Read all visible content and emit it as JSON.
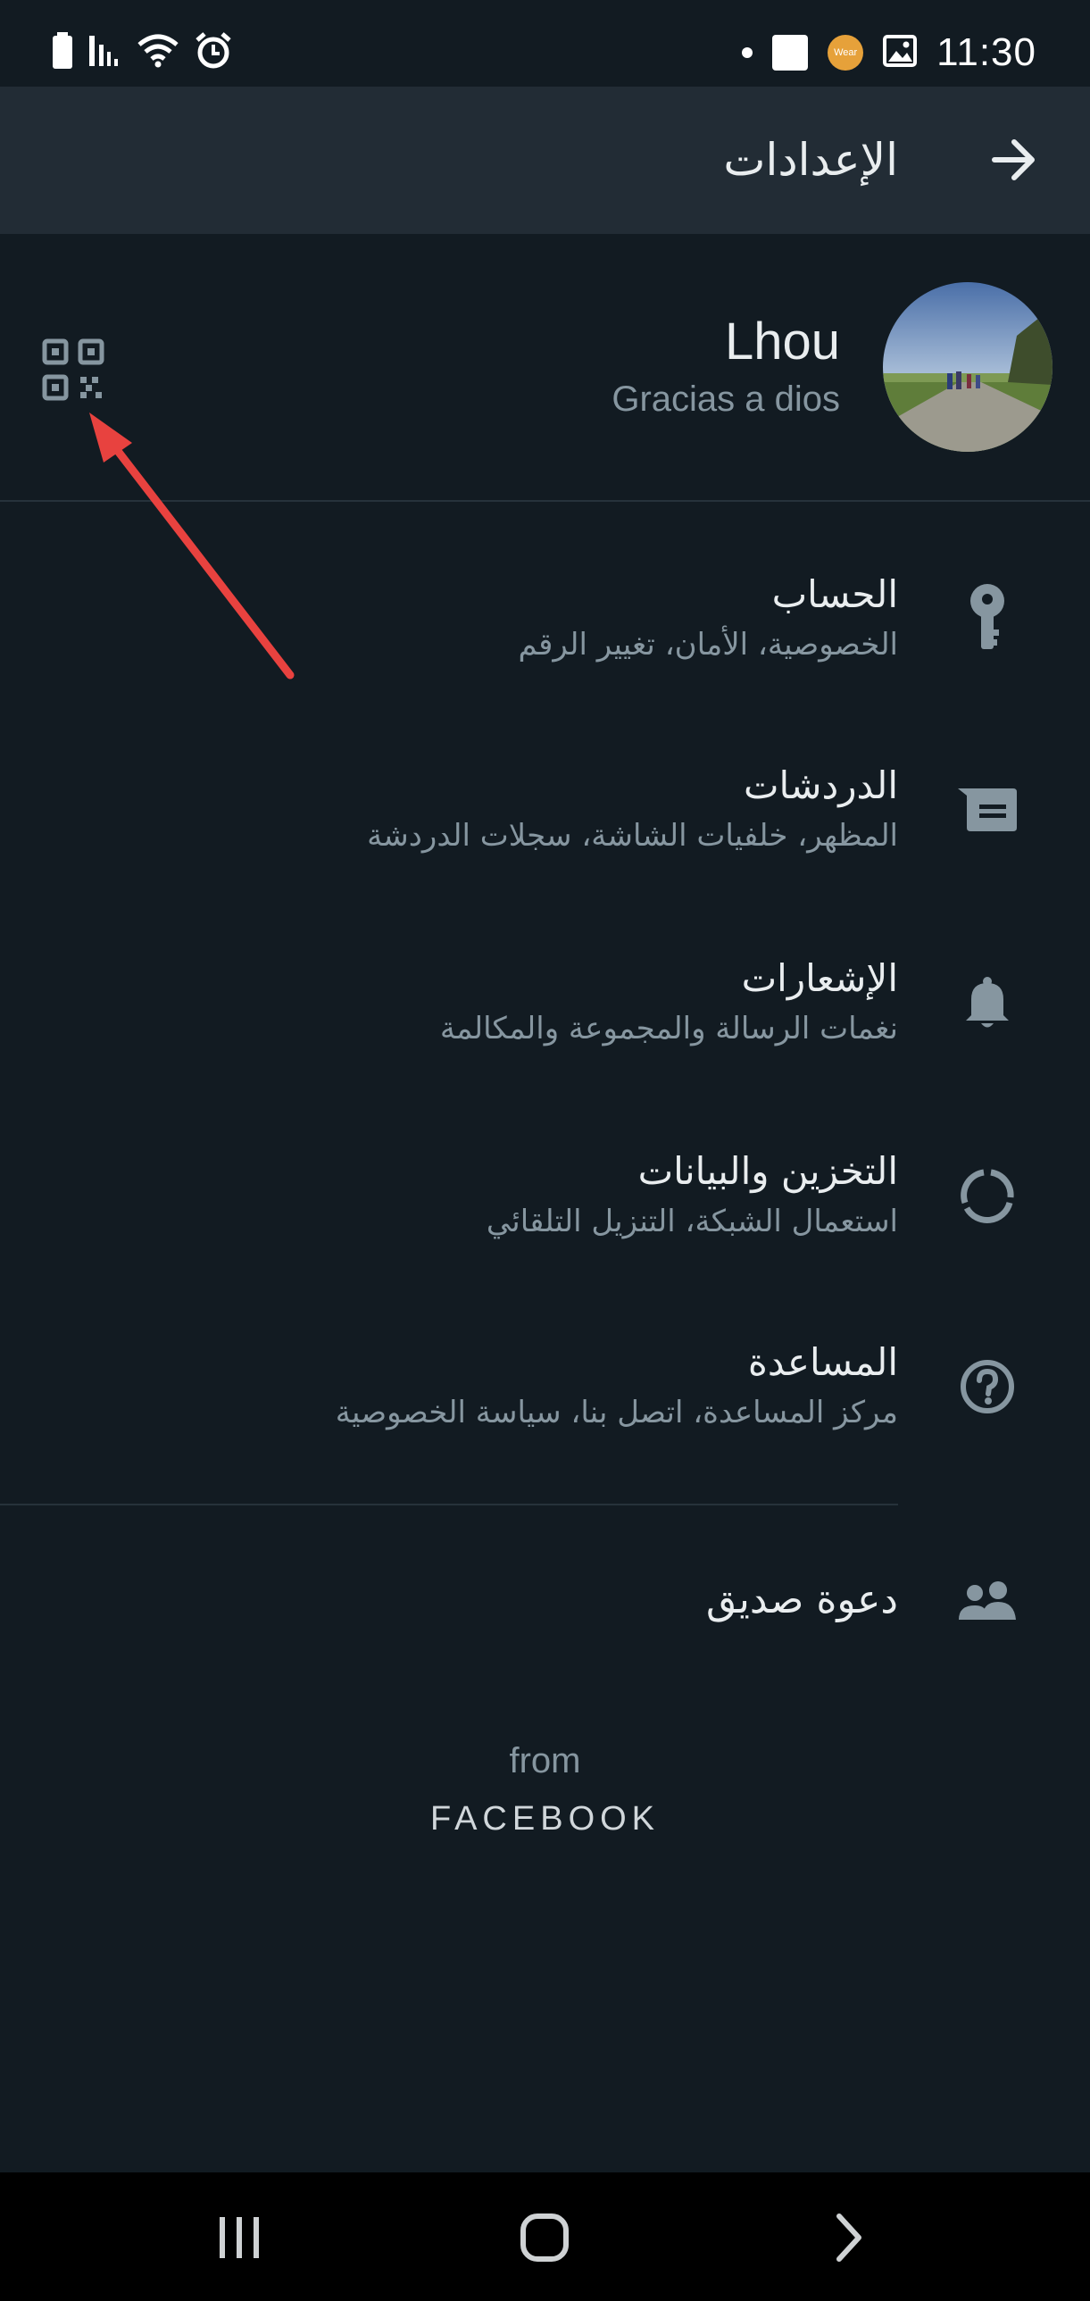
{
  "status_bar": {
    "time": "11:30",
    "left_icons": [
      "battery-icon",
      "signal-icon",
      "wifi-icon",
      "alarm-icon"
    ],
    "right_icons": [
      "notification-dot-icon",
      "app-notification-icon",
      "wear-icon",
      "gallery-icon"
    ],
    "wear_label": "Wear"
  },
  "header": {
    "title": "الإعدادات",
    "back_icon": "arrow-right-icon"
  },
  "profile": {
    "name": "Lhou",
    "status": "Gracias a dios",
    "qr_icon": "qr-code-icon"
  },
  "settings": [
    {
      "id": "account",
      "title": "الحساب",
      "subtitle": "الخصوصية، الأمان، تغيير الرقم",
      "icon": "key-icon"
    },
    {
      "id": "chats",
      "title": "الدردشات",
      "subtitle": "المظهر، خلفيات الشاشة، سجلات الدردشة",
      "icon": "chat-icon"
    },
    {
      "id": "notifications",
      "title": "الإشعارات",
      "subtitle": "نغمات الرسالة والمجموعة والمكالمة",
      "icon": "bell-icon"
    },
    {
      "id": "storage",
      "title": "التخزين والبيانات",
      "subtitle": "استعمال الشبكة، التنزيل التلقائي",
      "icon": "data-usage-icon"
    },
    {
      "id": "help",
      "title": "المساعدة",
      "subtitle": "مركز المساعدة، اتصل بنا، سياسة الخصوصية",
      "icon": "help-icon"
    }
  ],
  "invite": {
    "title": "دعوة صديق",
    "icon": "people-icon"
  },
  "footer": {
    "from": "from",
    "brand": "FACEBOOK"
  },
  "colors": {
    "background": "#121b22",
    "app_bar": "#222c35",
    "primary_text": "#e9edef",
    "secondary_text": "#8696a0",
    "icon": "#8696a0",
    "annotation": "#e8423f"
  },
  "nav_bar": {
    "icons": [
      "recent-apps-icon",
      "home-icon",
      "back-icon"
    ]
  }
}
